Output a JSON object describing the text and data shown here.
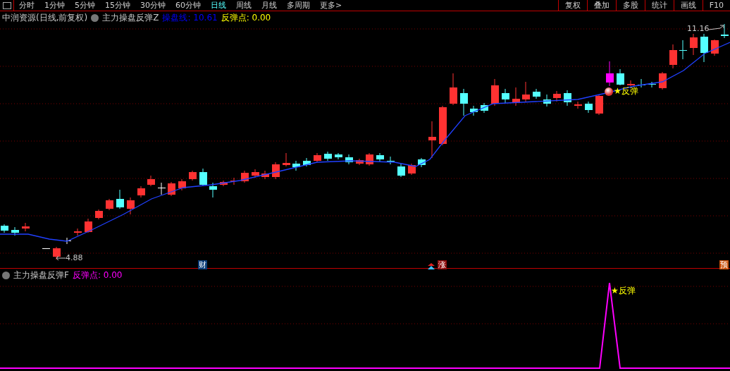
{
  "toolbar": {
    "periods": [
      {
        "label": "分时",
        "selected": false
      },
      {
        "label": "1分钟",
        "selected": false
      },
      {
        "label": "5分钟",
        "selected": false
      },
      {
        "label": "15分钟",
        "selected": false
      },
      {
        "label": "30分钟",
        "selected": false
      },
      {
        "label": "60分钟",
        "selected": false
      },
      {
        "label": "日线",
        "selected": true
      },
      {
        "label": "周线",
        "selected": false
      },
      {
        "label": "月线",
        "selected": false
      },
      {
        "label": "多周期",
        "selected": false
      },
      {
        "label": "更多>",
        "selected": false
      }
    ],
    "tools": [
      "复权",
      "叠加",
      "多股",
      "统计",
      "画线",
      "F10"
    ]
  },
  "main_panel": {
    "stock": "中润资源(日线,前复权)",
    "indicator": "主力操盘反弹Z",
    "lines": [
      {
        "label": "操盘线:",
        "value": "10.61",
        "color": "#0000ff"
      },
      {
        "label": "反弹点:",
        "value": "0.00",
        "color": "#ffff00"
      }
    ],
    "high_label": "11.16",
    "low_label": "4.88",
    "signal_label": "★反弹",
    "event_markers": [
      {
        "text": "财",
        "kind": "finance"
      },
      {
        "text": "涨",
        "kind": "rise"
      },
      {
        "text": "预",
        "kind": "forecast"
      }
    ]
  },
  "sub_panel": {
    "indicator": "主力操盘反弹F",
    "lines": [
      {
        "label": "反弹点:",
        "value": "0.00",
        "color": "#ff00ff"
      }
    ],
    "signal_label": "★反弹"
  }
}
